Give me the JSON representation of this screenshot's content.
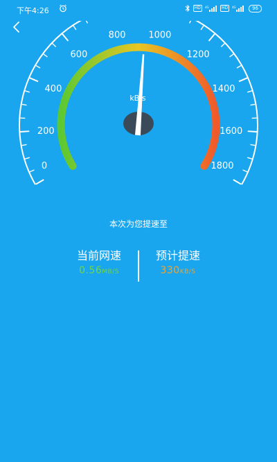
{
  "status_bar": {
    "time": "下午4:26",
    "hd1": "HD",
    "hd2": "HD",
    "battery": "96"
  },
  "gauge": {
    "unit": "kB/s",
    "ticks": [
      "0",
      "200",
      "400",
      "600",
      "800",
      "1000",
      "1200",
      "1400",
      "1600",
      "1800"
    ],
    "min": 0,
    "max": 1800,
    "needle_value": 900,
    "colors": {
      "start": "#5cc832",
      "mid": "#e8c624",
      "end": "#f05a2a",
      "hub": "#3a4a58",
      "background": "#1aa6ee"
    }
  },
  "main": {
    "subtitle": "本次为您提速至",
    "current": {
      "label": "当前网速",
      "value": "0.56",
      "unit": "MB/S",
      "color": "#6fd64a"
    },
    "estimated": {
      "label": "预计提速",
      "value": "330",
      "unit": "KB/S",
      "color": "#f2a12c"
    }
  }
}
